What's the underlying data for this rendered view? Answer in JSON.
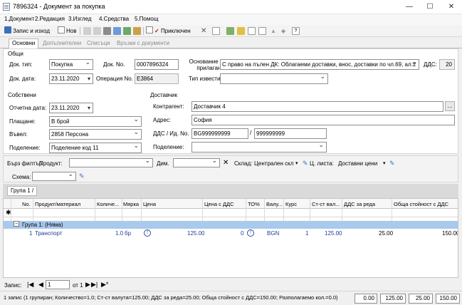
{
  "window": {
    "title": "7896324 - Документ за покупка",
    "minimize": "—",
    "maximize": "☐",
    "close": "✕"
  },
  "menu": [
    "1.Документ",
    "2.Редакция",
    "3.Изглед",
    "4.Средства",
    "5.Помощ"
  ],
  "toolbar": {
    "save_exit": "Запис и изход",
    "new": "Нов",
    "approved": "Приключен"
  },
  "tabs": [
    "Основни",
    "Допълнителни",
    "Списъци",
    "Връзки с документи"
  ],
  "general": {
    "group_label": "Общи",
    "doc_type_label": "Док. тип:",
    "doc_type": "Покупка",
    "doc_no_label": "Док. No.",
    "doc_no": "0007896324",
    "basis_label": "Основание за прилагане:",
    "basis": "С право на пълен ДК: Облагаеми доставки, внос, доставки по чл.69, ал.2",
    "vat_label": "ДДС:",
    "vat": "20",
    "doc_date_label": "Док. дата:",
    "doc_date": "23.11.2020",
    "operation_label": "Операция No.",
    "operation": "E3864",
    "notice_type_label": "Тип известие:",
    "notice_type": ""
  },
  "own": {
    "group_label": "Собствени",
    "report_date_label": "Отчетна дата:",
    "report_date": "23.11.2020",
    "payment_label": "Плащане:",
    "payment": "В брой",
    "entered_label": "Въвел:",
    "entered": "2858 Персона",
    "division_label": "Поделение:",
    "division": "Поделение код 11"
  },
  "supplier": {
    "group_label": "Доставчик",
    "contractor_label": "Контрагент:",
    "contractor": "Доставчик 4",
    "browse": "...",
    "address_label": "Адрес:",
    "address": "София",
    "vat_id_label": "ДДС / Ид. No.",
    "vat_no": "BG999999999",
    "slash": "/",
    "id_no": "999999999",
    "division_label": "Поделение:",
    "division": ""
  },
  "filter": {
    "quick_filter": "Бърз филтър",
    "product_label": "Продукт:",
    "product": "",
    "dim_label": "Дим.",
    "dim": "",
    "warehouse_label": "Склад:",
    "warehouse": "Централен скл",
    "pricelist_label": "Ц. листа:",
    "pricelist": "Доставни цени",
    "scheme_label": "Схема:",
    "scheme": ""
  },
  "grouping": {
    "chip": "Група 1 /"
  },
  "grid": {
    "columns": [
      "No.",
      "Продукт/материал",
      "Количе...",
      "Мярка",
      "Цена",
      "Цена с ДДС",
      "ТО%",
      "Валу...",
      "Курс",
      "Ст-ст вал...",
      "ДДС за реда",
      "Обща стойност с ДДС"
    ],
    "group_row": "Група 1: (Няма)",
    "rows": [
      {
        "no": "1",
        "product": "Транспорт",
        "qty": "1.0",
        "unit": "бр",
        "price": "125.00",
        "price_vat": "0",
        "to": "BGN",
        "currency": "1",
        "rate": "125.00",
        "cur_value": "25.00",
        "vat_row": "150.00"
      }
    ]
  },
  "nav": {
    "label": "Запис:",
    "record": "1",
    "of": "от 1"
  },
  "status": {
    "text": "1 запис (1 групиран; Количество=1.0; Ст-ст валута=125.00; ДДС за реда=25.00; Обща стойност с ДДС=150.00; Разполагаемо кол.=0.0)",
    "totals": [
      "0.00",
      "125.00",
      "25.00",
      "150.00"
    ]
  },
  "colors": {
    "group_row": "#a9c9ed",
    "link_text": "#1f3f9a"
  }
}
